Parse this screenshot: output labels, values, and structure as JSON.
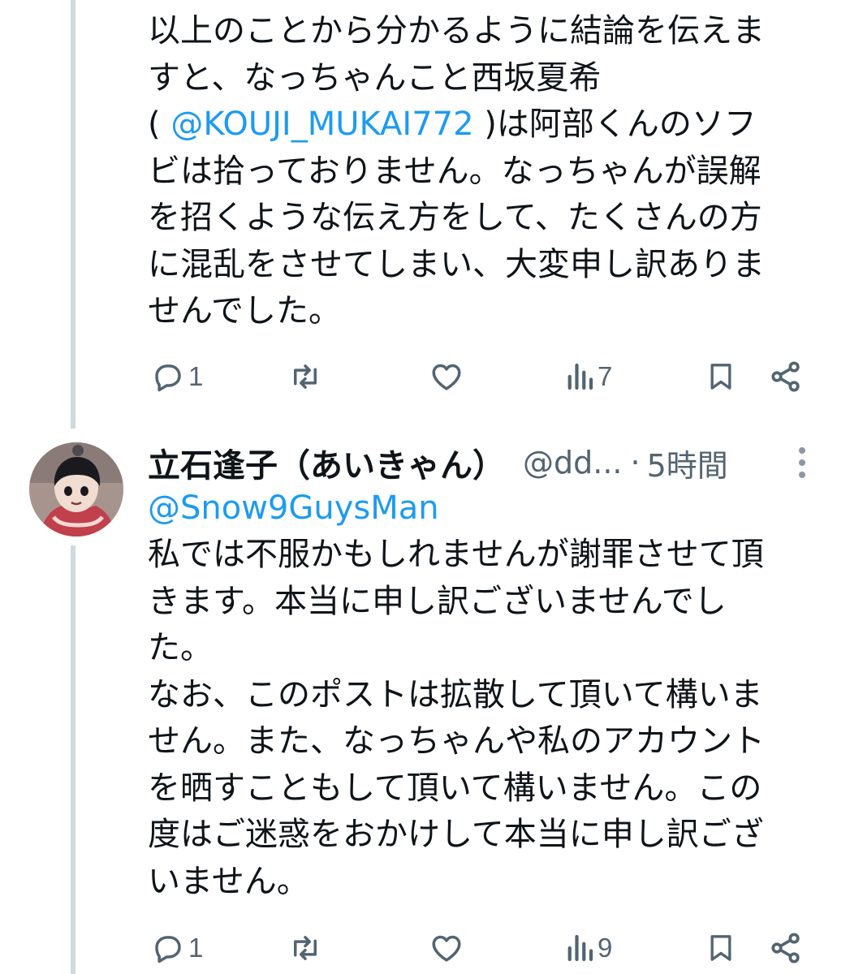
{
  "post1": {
    "lines": [
      "以上のことから分かるように結論を伝えま",
      "すと、なっちゃんこと西坂夏希",
      null,
      "ビは拾っておりません。なっちゃんが誤解",
      "を招くような伝え方をして、たくさんの方",
      "に混乱をさせてしまい、大変申し訳ありま",
      "せんでした。"
    ],
    "line3": {
      "open_paren": "( ",
      "mention": "@KOUJI_MUKAI772",
      "rest": " )は阿部くんのソフ"
    },
    "stats": {
      "replies": "1",
      "reposts": "",
      "likes": "",
      "views": "7"
    }
  },
  "post2": {
    "display_name": "立石逢子（あいきゃん）",
    "handle": "@dd...",
    "separator": "·",
    "time": "5時間",
    "reply_to": "@Snow9GuysMan",
    "lines": [
      "私では不服かもしれませんが謝罪させて頂",
      "きます。本当に申し訳ございませんでし",
      "た。",
      "なお、このポストは拡散して頂いて構いま",
      "せん。また、なっちゃんや私のアカウント",
      "を晒すこともして頂いて構いません。この",
      "度はご迷惑をおかけして本当に申し訳ござ",
      "いません。"
    ],
    "stats": {
      "replies": "1",
      "reposts": "",
      "likes": "",
      "views": "9"
    }
  },
  "icons": {
    "reply": "speech-bubble-icon",
    "repost": "repost-arrows-icon",
    "like": "heart-icon",
    "views": "bar-chart-icon",
    "bookmark": "bookmark-icon",
    "share": "share-nodes-icon",
    "more": "vertical-dots-icon"
  },
  "colors": {
    "text": "#0f1419",
    "secondary": "#536471",
    "link": "#1d9bf0",
    "thread_line": "#cfd9de"
  }
}
